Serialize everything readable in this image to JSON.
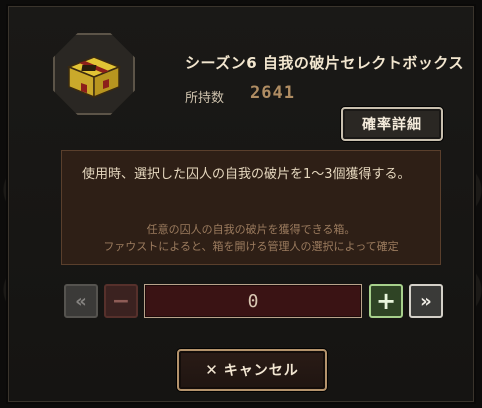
{
  "item": {
    "title": "シーズン6 自我の破片セレクトボックス",
    "owned_label": "所持数",
    "owned_value": "2641",
    "icon": "treasure-chest-icon"
  },
  "rate_button": {
    "label": "確率詳細"
  },
  "description": {
    "main": "使用時、選択した囚人の自我の破片を1～3個獲得する。",
    "sub_lines": [
      "任意の囚人の自我の破片を獲得できる箱。",
      "ファウストによると、箱を開ける管理人の選択によって確定"
    ]
  },
  "quantity": {
    "value": "0",
    "first_symbol": "«",
    "minus_symbol": "−",
    "plus_symbol": "+",
    "last_symbol": "»"
  },
  "cancel_button": {
    "icon": "✕",
    "label": "キャンセル"
  },
  "colors": {
    "accent_gold": "#b08d63",
    "desc_bg": "#2e1f16",
    "qty_bg": "#3a1314",
    "plus_green": "#a7d08c"
  }
}
